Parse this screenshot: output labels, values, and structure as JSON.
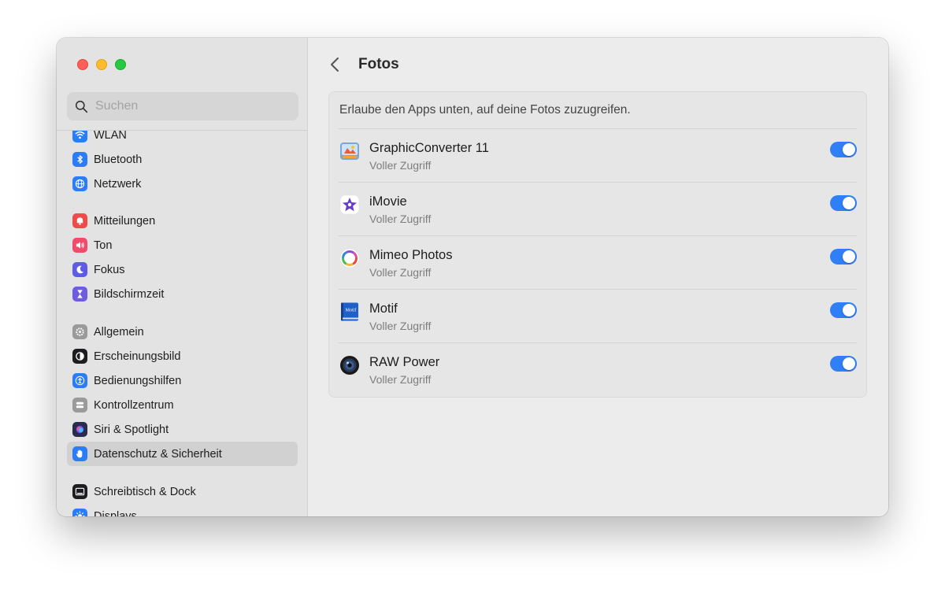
{
  "search": {
    "placeholder": "Suchen"
  },
  "sidebar": {
    "items": [
      {
        "label": "WLAN",
        "icon": "wifi-icon",
        "color": "#2a7df6"
      },
      {
        "label": "Bluetooth",
        "icon": "bluetooth-icon",
        "color": "#2a7df6"
      },
      {
        "label": "Netzwerk",
        "icon": "globe-icon",
        "color": "#2a7df6"
      },
      {
        "label": "Mitteilungen",
        "icon": "bell-icon",
        "color": "#f04b4b"
      },
      {
        "label": "Ton",
        "icon": "speaker-icon",
        "color": "#f04b6a"
      },
      {
        "label": "Fokus",
        "icon": "moon-icon",
        "color": "#5e5ce6"
      },
      {
        "label": "Bildschirmzeit",
        "icon": "hourglass-icon",
        "color": "#6e5ce0"
      },
      {
        "label": "Allgemein",
        "icon": "gear-icon",
        "color": "#9a9a9a"
      },
      {
        "label": "Erscheinungsbild",
        "icon": "appearance-icon",
        "color": "#1d1d1f"
      },
      {
        "label": "Bedienungshilfen",
        "icon": "accessibility-icon",
        "color": "#2a7df6"
      },
      {
        "label": "Kontrollzentrum",
        "icon": "switches-icon",
        "color": "#9a9a9a"
      },
      {
        "label": "Siri & Spotlight",
        "icon": "siri-icon",
        "color": "#2b2b4d"
      },
      {
        "label": "Datenschutz & Sicherheit",
        "icon": "hand-icon",
        "color": "#2a7df6"
      },
      {
        "label": "Schreibtisch & Dock",
        "icon": "dock-icon",
        "color": "#1d1d1f"
      },
      {
        "label": "Displays",
        "icon": "sun-icon",
        "color": "#2a7df6"
      }
    ]
  },
  "main": {
    "title": "Fotos",
    "description": "Erlaube den Apps unten, auf deine Fotos zuzugreifen.",
    "apps": [
      {
        "name": "GraphicConverter 11",
        "access": "Voller Zugriff",
        "enabled": true,
        "icon": "graphicconverter-icon"
      },
      {
        "name": "iMovie",
        "access": "Voller Zugriff",
        "enabled": true,
        "icon": "imovie-icon"
      },
      {
        "name": "Mimeo Photos",
        "access": "Voller Zugriff",
        "enabled": true,
        "icon": "mimeo-icon"
      },
      {
        "name": "Motif",
        "access": "Voller Zugriff",
        "enabled": true,
        "icon": "motif-icon",
        "icon_text": "Motif"
      },
      {
        "name": "RAW Power",
        "access": "Voller Zugriff",
        "enabled": true,
        "icon": "rawpower-icon"
      }
    ]
  },
  "colors": {
    "accent": "#2f7ff6",
    "selected": "#d1d1d1"
  }
}
